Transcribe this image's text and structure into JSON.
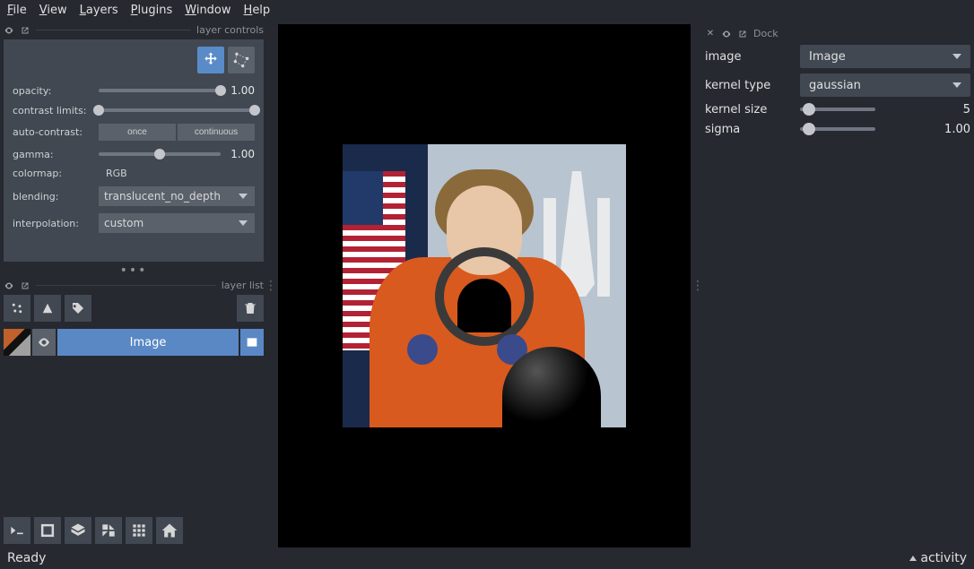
{
  "menu": {
    "file": "File",
    "view": "View",
    "layers": "Layers",
    "plugins": "Plugins",
    "window": "Window",
    "help": "Help"
  },
  "left": {
    "controls_title": "layer controls",
    "opacity_label": "opacity:",
    "opacity_value": "1.00",
    "contrast_label": "contrast limits:",
    "autocontrast_label": "auto-contrast:",
    "autocontrast_once": "once",
    "autocontrast_continuous": "continuous",
    "gamma_label": "gamma:",
    "gamma_value": "1.00",
    "colormap_label": "colormap:",
    "colormap_value": "RGB",
    "blending_label": "blending:",
    "blending_value": "translucent_no_depth",
    "interpolation_label": "interpolation:",
    "interpolation_value": "custom",
    "layerlist_title": "layer list",
    "layer_name": "Image"
  },
  "right": {
    "dock_label": "Dock",
    "image_label": "image",
    "image_value": "Image",
    "kernel_type_label": "kernel type",
    "kernel_type_value": "gaussian",
    "kernel_size_label": "kernel size",
    "kernel_size_value": "5",
    "sigma_label": "sigma",
    "sigma_value": "1.00"
  },
  "status": {
    "ready": "Ready",
    "activity": "activity"
  }
}
